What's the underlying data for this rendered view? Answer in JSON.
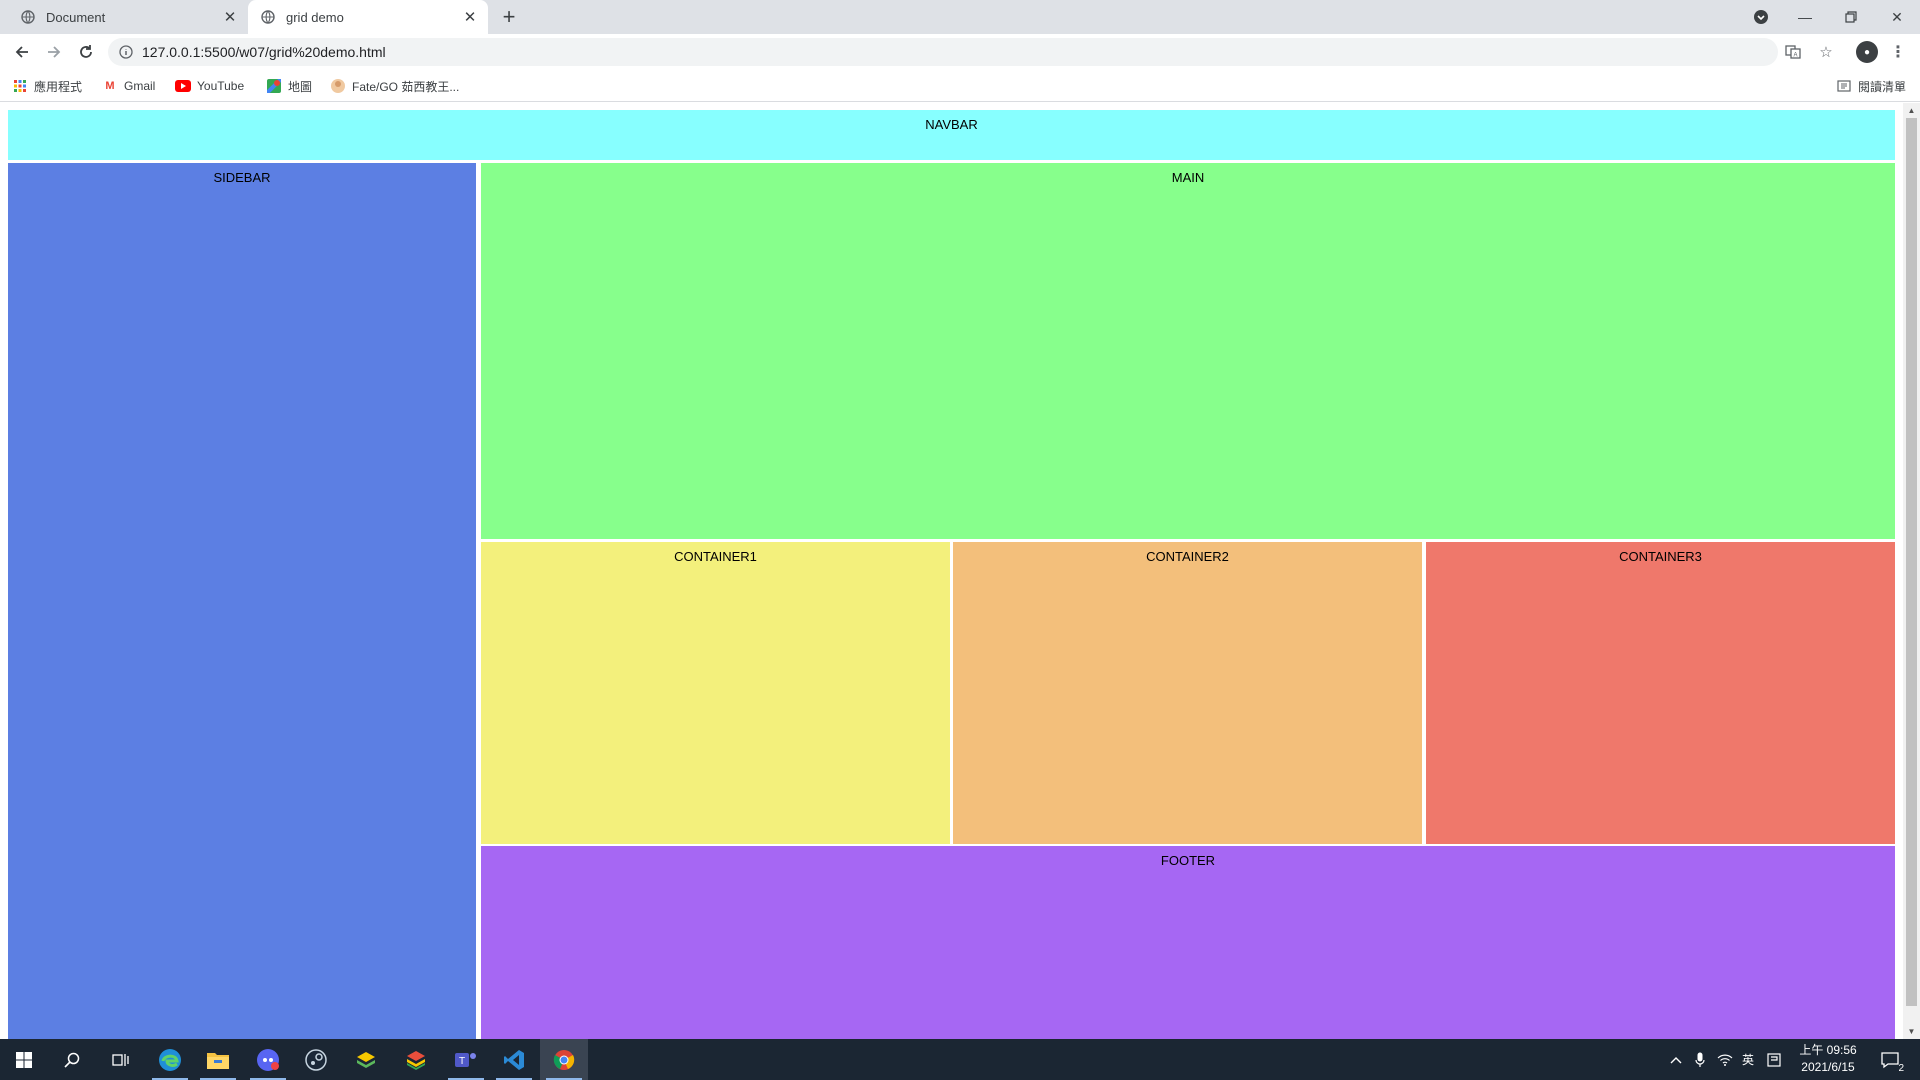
{
  "browser": {
    "tabs": [
      {
        "title": "Document",
        "active": false
      },
      {
        "title": "grid demo",
        "active": true
      }
    ],
    "url": "127.0.0.1:5500/w07/grid%20demo.html",
    "bookmarks": [
      {
        "label": "應用程式",
        "icon": "apps-grid-icon"
      },
      {
        "label": "Gmail",
        "icon": "gmail-icon"
      },
      {
        "label": "YouTube",
        "icon": "youtube-icon"
      },
      {
        "label": "地圖",
        "icon": "maps-icon"
      },
      {
        "label": "Fate/GO 茹西教王...",
        "icon": "fgo-icon"
      }
    ],
    "reading_list": "閱讀清單"
  },
  "page": {
    "navbar": "NAVBAR",
    "sidebar": "SIDEBAR",
    "main": "MAIN",
    "container1": "CONTAINER1",
    "container2": "CONTAINER2",
    "container3": "CONTAINER3",
    "footer": "FOOTER",
    "colors": {
      "navbar": "#87ffff",
      "sidebar": "#5c7fe3",
      "main": "#87ff8c",
      "container1": "#f3f07c",
      "container2": "#f3bf7b",
      "container3": "#ef786b",
      "footer": "#a667f3"
    }
  },
  "taskbar": {
    "apps": [
      "windows-start-icon",
      "search-icon",
      "task-view-icon",
      "edge-icon",
      "file-explorer-icon",
      "discord-icon",
      "steam-icon",
      "bluestacks-icon",
      "bluestacks-x-icon",
      "teams-icon",
      "vscode-icon",
      "chrome-icon"
    ],
    "ime": "英",
    "time": "上午 09:56",
    "date": "2021/6/15",
    "notifications": "2"
  }
}
